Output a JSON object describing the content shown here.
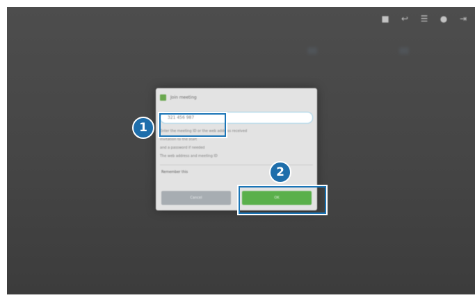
{
  "toolbar": {
    "icons": [
      "video-camera-icon",
      "call-transfer-icon",
      "participants-icon",
      "info-icon",
      "exit-icon"
    ],
    "glyphs": [
      "■",
      "↩",
      "☰",
      "●",
      "⇥"
    ]
  },
  "dialog": {
    "title": "Join meeting",
    "input_value": "321 456 987",
    "body_lines": [
      "Enter the meeting ID or the web address received",
      "invitation to the start",
      "and a password if needed",
      "The web address and meeting ID"
    ],
    "checkbox_label": "Remember this",
    "cancel_label": "Cancel",
    "ok_label": "OK"
  },
  "callouts": {
    "one": "1",
    "two": "2"
  },
  "colors": {
    "screen_bg": "#464646",
    "dialog_bg": "#e3e3e3",
    "ok_green": "#5ab04b",
    "cancel_gray": "#a7adb2",
    "callout_blue": "#1e6eab",
    "highlight_blue": "#1a75b7"
  }
}
